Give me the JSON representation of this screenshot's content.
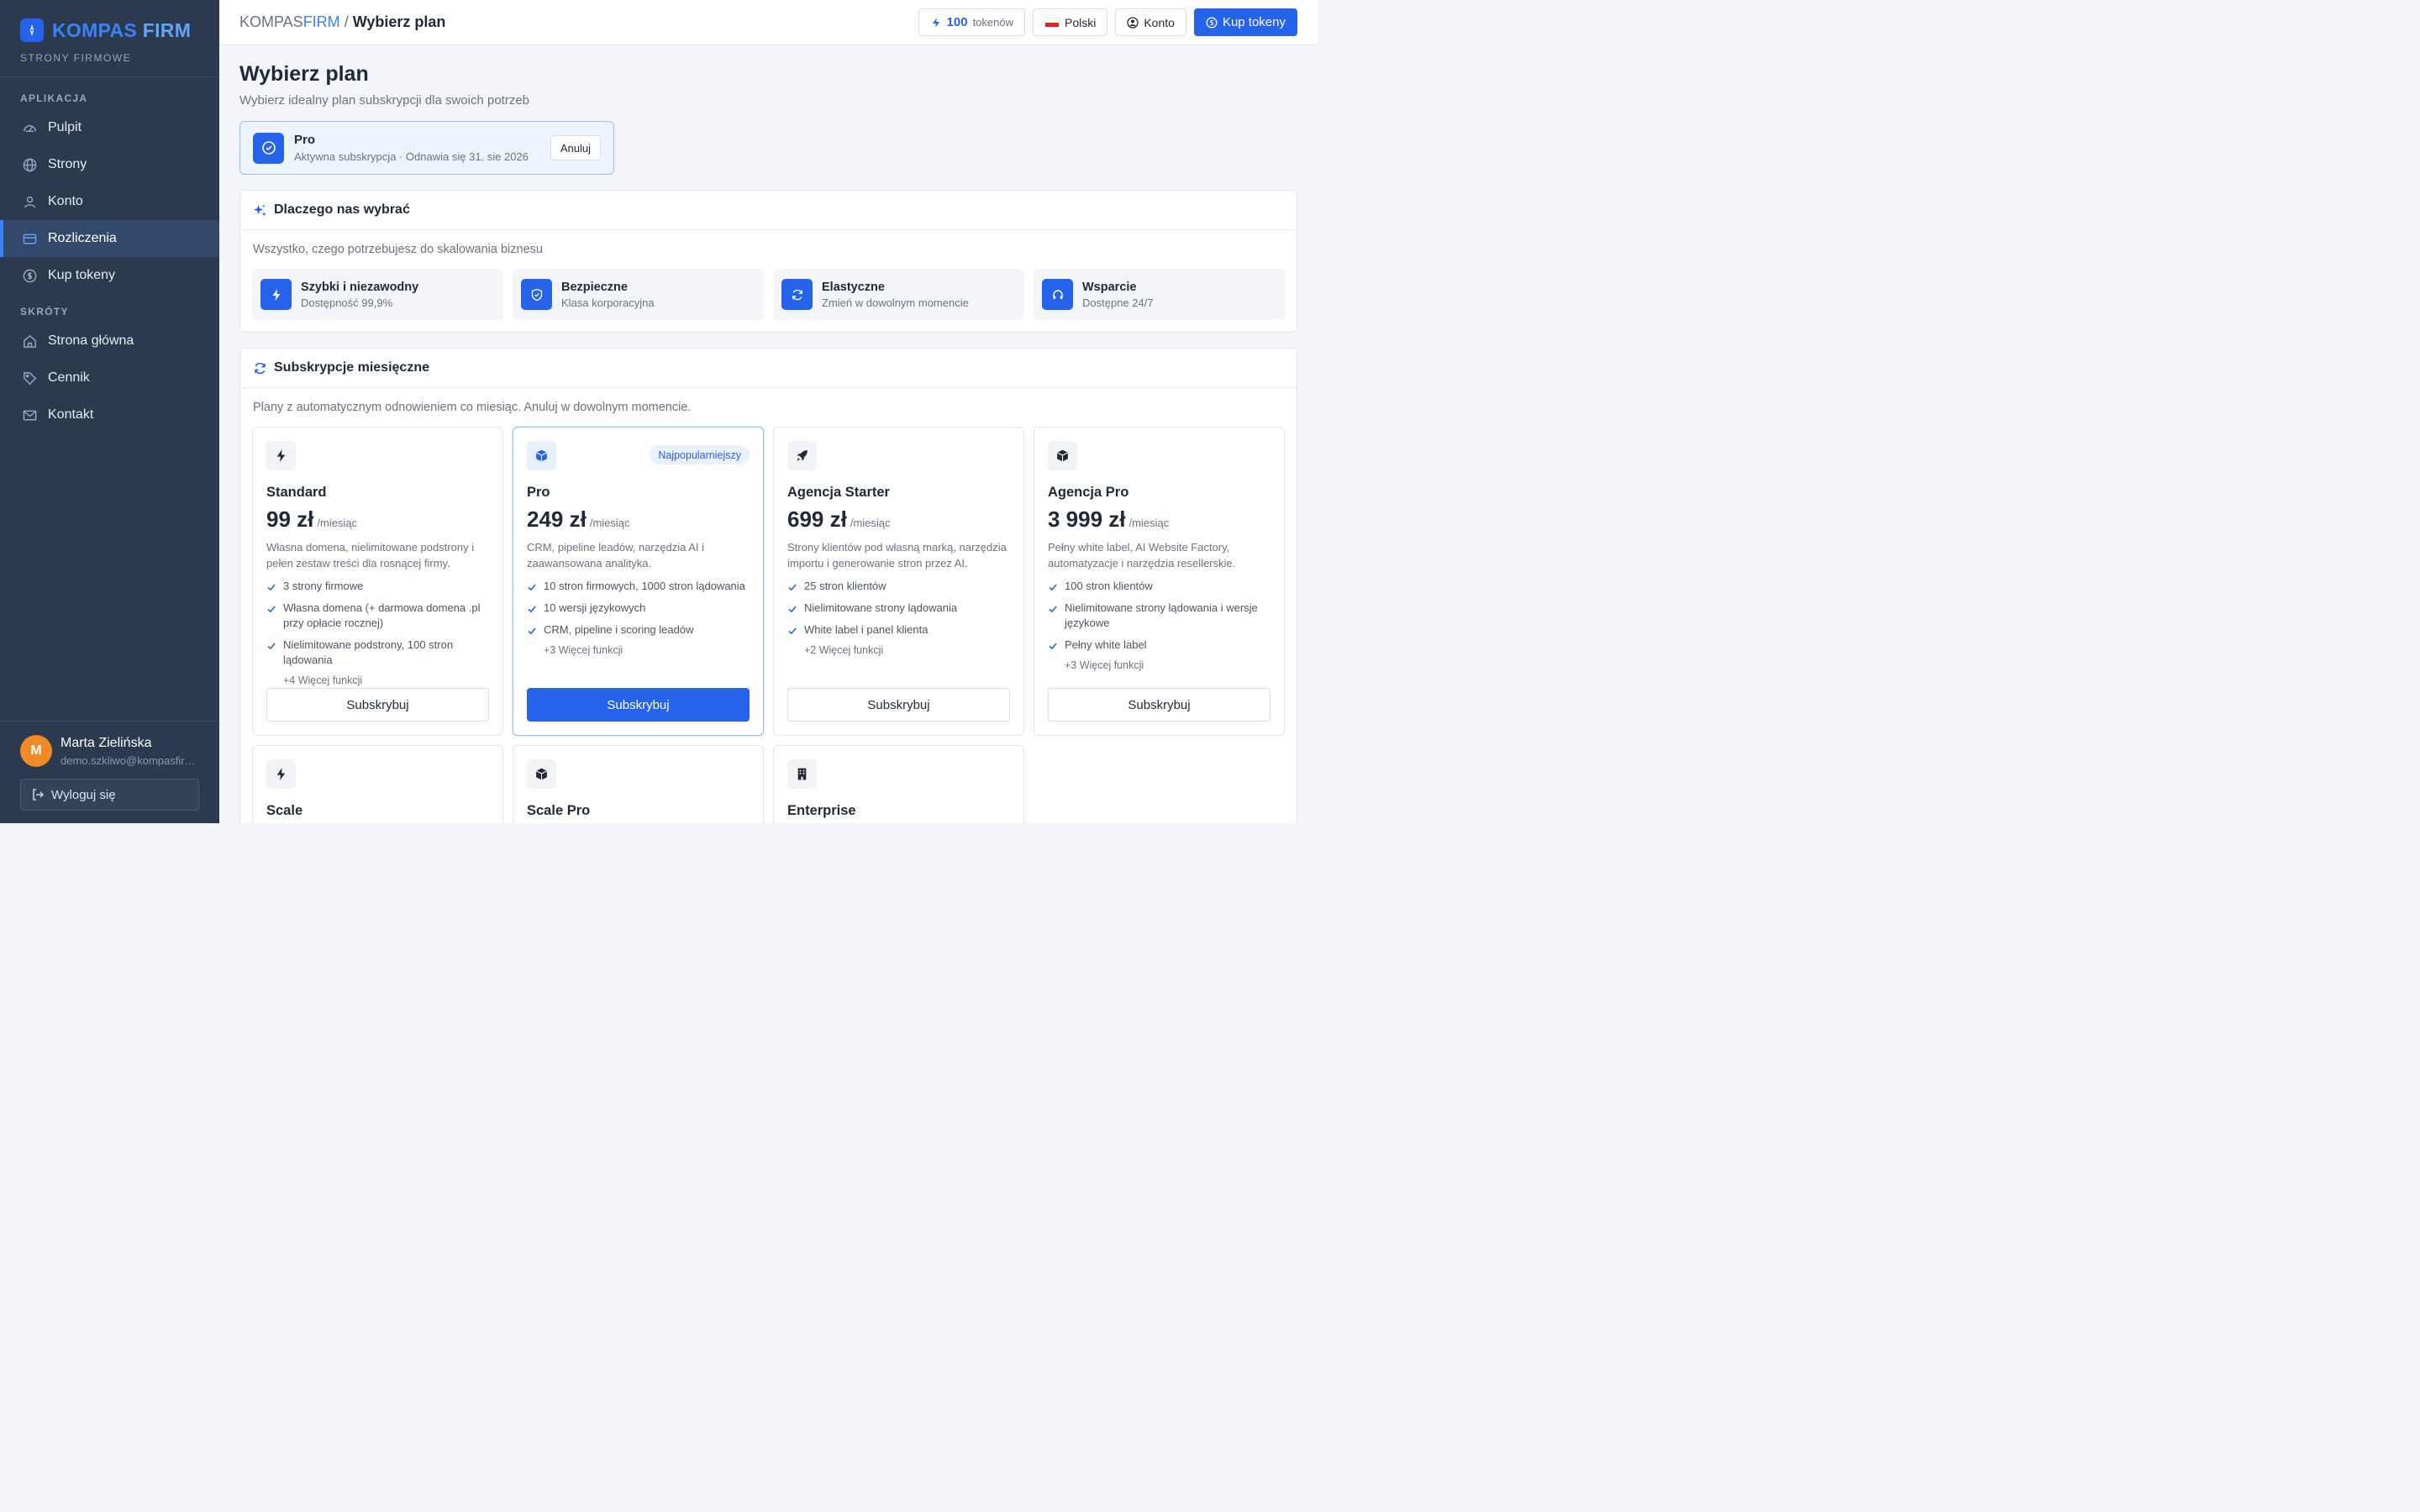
{
  "brand": {
    "name_part1": "KOMPAS",
    "name_part2": "FIRM",
    "subtitle": "STRONY FIRMOWE"
  },
  "sidebar": {
    "section_app": "APLIKACJA",
    "app_items": [
      {
        "label": "Pulpit",
        "icon": "gauge-icon"
      },
      {
        "label": "Strony",
        "icon": "globe-icon"
      },
      {
        "label": "Konto",
        "icon": "user-icon"
      },
      {
        "label": "Rozliczenia",
        "icon": "credit-card-icon",
        "active": true
      },
      {
        "label": "Kup tokeny",
        "icon": "coin-icon"
      }
    ],
    "section_shortcuts": "SKRÓTY",
    "shortcut_items": [
      {
        "label": "Strona główna",
        "icon": "home-icon"
      },
      {
        "label": "Cennik",
        "icon": "tag-icon"
      },
      {
        "label": "Kontakt",
        "icon": "mail-icon"
      }
    ],
    "user": {
      "initial": "M",
      "name": "Marta Zielińska",
      "email": "demo.szkliwo@kompasfirm.pl"
    },
    "logout_label": "Wyloguj się"
  },
  "topbar": {
    "crumb_root1": "KOMPAS",
    "crumb_root2": "FIRM",
    "crumb_sep": "/",
    "crumb_current": "Wybierz plan",
    "tokens_count": "100",
    "tokens_label": "tokenów",
    "language": "Polski",
    "account": "Konto",
    "buy_tokens": "Kup tokeny"
  },
  "page": {
    "title": "Wybierz plan",
    "subtitle": "Wybierz idealny plan subskrypcji dla swoich potrzeb"
  },
  "active_plan": {
    "name": "Pro",
    "status": "Aktywna subskrypcja · Odnawia się 31. sie 2026",
    "cancel": "Anuluj"
  },
  "why": {
    "title": "Dlaczego nas wybrać",
    "subtitle": "Wszystko, czego potrzebujesz do skalowania biznesu",
    "features": [
      {
        "title": "Szybki i niezawodny",
        "desc": "Dostępność 99,9%",
        "icon": "bolt-icon"
      },
      {
        "title": "Bezpieczne",
        "desc": "Klasa korporacyjna",
        "icon": "shield-icon"
      },
      {
        "title": "Elastyczne",
        "desc": "Zmień w dowolnym momencie",
        "icon": "refresh-icon"
      },
      {
        "title": "Wsparcie",
        "desc": "Dostępne 24/7",
        "icon": "headset-icon"
      }
    ]
  },
  "monthly": {
    "title": "Subskrypcje miesięczne",
    "subtitle": "Plany z automatycznym odnowieniem co miesiąc. Anuluj w dowolnym momencie.",
    "per": "/miesiąc",
    "subscribe": "Subskrybuj",
    "popular_badge": "Najpopularniejszy",
    "plans": [
      {
        "name": "Standard",
        "price": "99 zł",
        "icon": "bolt-icon",
        "desc": "Własna domena, nielimitowane podstrony i pełen zestaw treści dla rosnącej firmy.",
        "features": [
          "3 strony firmowe",
          "Własna domena (+ darmowa domena .pl przy opłacie rocznej)",
          "Nielimitowane podstrony, 100 stron lądowania"
        ],
        "more": "+4 Więcej funkcji"
      },
      {
        "name": "Pro",
        "price": "249 zł",
        "icon": "cube-icon",
        "popular": true,
        "desc": "CRM, pipeline leadów, narzędzia AI i zaawansowana analityka.",
        "features": [
          "10 stron firmowych, 1000 stron lądowania",
          "10 wersji językowych",
          "CRM, pipeline i scoring leadów"
        ],
        "more": "+3 Więcej funkcji"
      },
      {
        "name": "Agencja Starter",
        "price": "699 zł",
        "icon": "rocket-icon",
        "desc": "Strony klientów pod własną marką, narzędzia importu i generowanie stron przez AI.",
        "features": [
          "25 stron klientów",
          "Nielimitowane strony lądowania",
          "White label i panel klienta"
        ],
        "more": "+2 Więcej funkcji"
      },
      {
        "name": "Agencja Pro",
        "price": "3 999 zł",
        "icon": "cube-icon",
        "desc": "Pełny white label, AI Website Factory, automatyzacje i narzędzia resellerskie.",
        "features": [
          "100 stron klientów",
          "Nielimitowane strony lądowania i wersje językowe",
          "Pełny white label"
        ],
        "more": "+3 Więcej funkcji"
      }
    ],
    "more_plans": [
      {
        "name": "Scale",
        "icon": "bolt-icon"
      },
      {
        "name": "Scale Pro",
        "icon": "cube-icon"
      },
      {
        "name": "Enterprise",
        "icon": "building-icon"
      }
    ]
  },
  "colors": {
    "accent": "#2563eb",
    "sidebar_bg": "#2b3a4e",
    "avatar": "#f08a24"
  }
}
